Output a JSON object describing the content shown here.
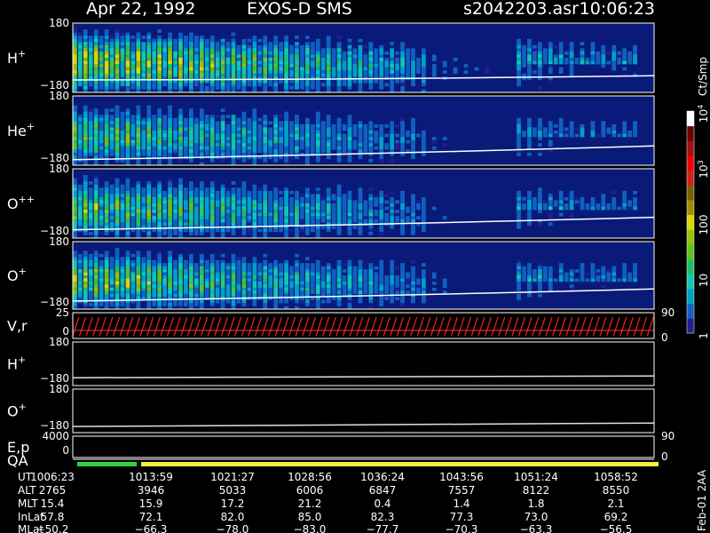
{
  "header": {
    "date": "Apr 22, 1992",
    "instrument": "EXOS-D SMS",
    "file": "s2042203.asr",
    "time": "10:06:23"
  },
  "colorbar": {
    "unit": "Ct/Smp",
    "labels": [
      {
        "text": "1",
        "level": 0
      },
      {
        "text": "10",
        "level": 1
      },
      {
        "text": "100",
        "level": 2
      },
      {
        "text": "10",
        "sup": "3",
        "level": 3
      },
      {
        "text": "10",
        "sup": "4",
        "level": 4
      }
    ],
    "colors": [
      "#202090",
      "#1060c0",
      "#00a0c8",
      "#10c8b0",
      "#20c060",
      "#60c020",
      "#98c010",
      "#d8d800",
      "#a09000",
      "#786000",
      "#d02020",
      "#f00000",
      "#a01010",
      "#700000",
      "#ffffff"
    ]
  },
  "chart_data": {
    "type": "heatmap",
    "panels": [
      {
        "name": "H",
        "sup": "+",
        "ymax": "180",
        "ymin": "−180",
        "kind": "spectrogram",
        "intensity": 1.0,
        "curve": [
          0.82,
          0.76
        ]
      },
      {
        "name": "He",
        "sup": "+",
        "ymax": "180",
        "ymin": "−180",
        "kind": "spectrogram",
        "intensity": 0.7,
        "curve": [
          0.92,
          0.72
        ]
      },
      {
        "name": "O",
        "sup": "++",
        "ymax": "180",
        "ymin": "−180",
        "kind": "spectrogram",
        "intensity": 0.75,
        "curve": [
          0.88,
          0.7
        ]
      },
      {
        "name": "O",
        "sup": "+",
        "ymax": "180",
        "ymin": "−180",
        "kind": "spectrogram",
        "intensity": 0.8,
        "curve": [
          0.88,
          0.7
        ]
      },
      {
        "name": "V,r",
        "sup": "",
        "ymax": "25",
        "ymin": "0",
        "kind": "sawtooth",
        "right_tick": "90",
        "right_tick2": "0"
      },
      {
        "name": "H",
        "sup": "+",
        "ymax": "180",
        "ymin": "−180",
        "kind": "line",
        "curve": [
          0.82,
          0.78
        ]
      },
      {
        "name": "O",
        "sup": "+",
        "ymax": "180",
        "ymin": "−180",
        "kind": "line",
        "curve": [
          0.86,
          0.78
        ]
      },
      {
        "name": "E,p",
        "sup": "",
        "ymax": "4000",
        "ymin": "0",
        "kind": "empty",
        "right_tick": "90",
        "right_tick2": "0"
      }
    ],
    "qa": {
      "label": "QA",
      "segments": [
        {
          "from": 0,
          "to": 0.11,
          "color": "#30d040"
        },
        {
          "from": 0.11,
          "to": 1.0,
          "color": "#f0f040"
        }
      ]
    },
    "table": {
      "row_labels": [
        "UT",
        "ALT",
        "MLT",
        "InLat",
        "MLat"
      ],
      "columns": [
        [
          "1006:23",
          "2765",
          "15.4",
          "57.8",
          "−50.2"
        ],
        [
          "1013:59",
          "3946",
          "15.9",
          "72.1",
          "−66.3"
        ],
        [
          "1021:27",
          "5033",
          "17.2",
          "82.0",
          "−78.0"
        ],
        [
          "1028:56",
          "6006",
          "21.2",
          "85.0",
          "−83.0"
        ],
        [
          "1036:24",
          "6847",
          "0.4",
          "82.3",
          "−77.7"
        ],
        [
          "1043:56",
          "7557",
          "1.4",
          "77.3",
          "−70.3"
        ],
        [
          "1051:24",
          "8122",
          "1.8",
          "73.0",
          "−63.3"
        ],
        [
          "1058:52",
          "8550",
          "2.1",
          "69.2",
          "−56.5"
        ]
      ]
    }
  },
  "footer": {
    "side_label": "Feb-01 2AA"
  }
}
